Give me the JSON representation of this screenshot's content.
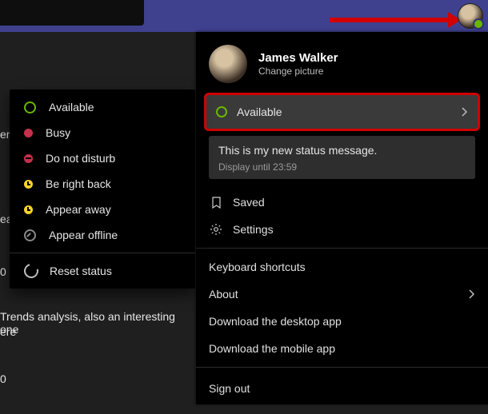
{
  "topbar": {},
  "background": {
    "line1": "en",
    "line2": "ea",
    "line3": "0",
    "snippet_a": "Trends analysis, also an interesting one",
    "snippet_b": "ere",
    "line4": "0"
  },
  "profile": {
    "name": "James Walker",
    "change_picture": "Change picture",
    "status_label": "Available",
    "status_message": "This is my new status message.",
    "display_until": "Display until 23:59",
    "saved": "Saved",
    "settings": "Settings",
    "keyboard": "Keyboard shortcuts",
    "about": "About",
    "download_desktop": "Download the desktop app",
    "download_mobile": "Download the mobile app",
    "sign_out": "Sign out"
  },
  "status_menu": {
    "available": "Available",
    "busy": "Busy",
    "dnd": "Do not disturb",
    "brb": "Be right back",
    "away": "Appear away",
    "offline": "Appear offline",
    "reset": "Reset status"
  }
}
